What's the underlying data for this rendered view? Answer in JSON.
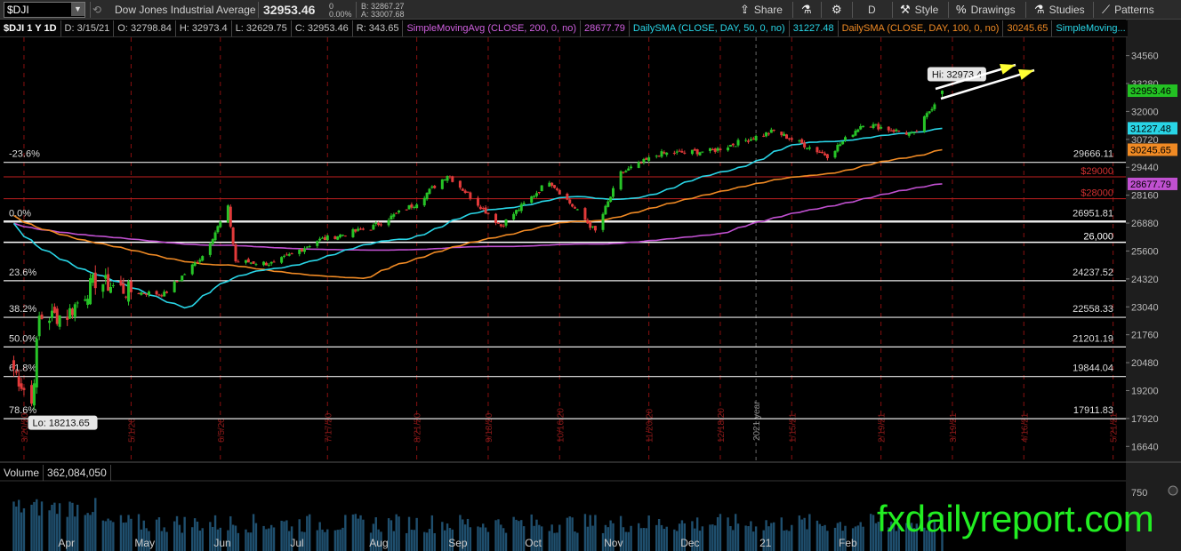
{
  "toolbar": {
    "symbol_value": "$DJI",
    "description": "Dow Jones Industrial Average",
    "last_price": "32953.46",
    "change": "0",
    "change_pct": "0.00%",
    "bid": "B: 32867.27",
    "ask": "A: 33007.68",
    "share_label": "Share",
    "period_label": "D",
    "style_label": "Style",
    "drawings_label": "Drawings",
    "studies_label": "Studies",
    "patterns_label": "Patterns"
  },
  "infobar": {
    "symbol": "$DJI 1 Y 1D",
    "date": "D: 3/15/21",
    "open": "O: 32798.84",
    "high": "H: 32973.4",
    "low": "L: 32629.75",
    "close": "C: 32953.46",
    "range": "R: 343.65",
    "sma200_label": "SimpleMovingAvg (CLOSE, 200, 0, no)",
    "sma200_value": "28677.79",
    "sma50_label": "DailySMA (CLOSE, DAY, 50, 0, no)",
    "sma50_value": "31227.48",
    "sma100_label": "DailySMA (CLOSE, DAY, 100, 0, no)",
    "sma100_value": "30245.65",
    "more_label": "SimpleMoving..."
  },
  "colors": {
    "up": "#27c427",
    "down": "#e23a3a",
    "sma50": "#29d5e6",
    "sma100": "#f08a24",
    "sma200": "#c050d0",
    "price_tag": "#23c123",
    "arrow": "#ffff33"
  },
  "price_axis": {
    "ticks": [
      "34560",
      "33280",
      "32000",
      "30720",
      "29440",
      "28160",
      "26880",
      "25600",
      "24320",
      "23040",
      "21760",
      "20480",
      "19200",
      "17920",
      "16640"
    ],
    "last_price_tag": "32953.46",
    "sma50_tag": "31227.48",
    "sma100_tag": "30245.65",
    "sma200_tag": "28677.79"
  },
  "chart_data": {
    "type": "candlestick",
    "symbol": "$DJI",
    "period": "1 Y 1D",
    "ylim": [
      16000,
      35400
    ],
    "x_month_labels": [
      "Apr",
      "May",
      "Jun",
      "Jul",
      "Aug",
      "Sep",
      "Oct",
      "Nov",
      "Dec",
      "21",
      "Feb"
    ],
    "close_path": [
      {
        "date": "2020-03-16",
        "close": 20189
      },
      {
        "date": "2020-03-23",
        "close": 18592
      },
      {
        "date": "2020-03-26",
        "close": 22552
      },
      {
        "date": "2020-04-06",
        "close": 22680
      },
      {
        "date": "2020-04-17",
        "close": 24242
      },
      {
        "date": "2020-05-01",
        "close": 23724
      },
      {
        "date": "2020-05-14",
        "close": 23625
      },
      {
        "date": "2020-05-29",
        "close": 25383
      },
      {
        "date": "2020-06-08",
        "close": 27572
      },
      {
        "date": "2020-06-11",
        "close": 25128
      },
      {
        "date": "2020-06-26",
        "close": 25015
      },
      {
        "date": "2020-07-13",
        "close": 26085
      },
      {
        "date": "2020-08-03",
        "close": 26664
      },
      {
        "date": "2020-08-20",
        "close": 27739
      },
      {
        "date": "2020-09-02",
        "close": 29100
      },
      {
        "date": "2020-09-23",
        "close": 26763
      },
      {
        "date": "2020-10-12",
        "close": 28837
      },
      {
        "date": "2020-10-30",
        "close": 26501
      },
      {
        "date": "2020-11-09",
        "close": 29157
      },
      {
        "date": "2020-11-24",
        "close": 30046
      },
      {
        "date": "2020-12-15",
        "close": 30199
      },
      {
        "date": "2021-01-08",
        "close": 31097
      },
      {
        "date": "2021-01-29",
        "close": 29982
      },
      {
        "date": "2021-02-12",
        "close": 31458
      },
      {
        "date": "2021-03-04",
        "close": 30924
      },
      {
        "date": "2021-03-15",
        "close": 32953
      }
    ],
    "hi_label": "Hi: 32973.4",
    "lo_label": "Lo: 18213.65",
    "sma_lines": [
      {
        "name": "DailySMA 50",
        "last": 31227.48
      },
      {
        "name": "DailySMA 100",
        "last": 30245.65
      },
      {
        "name": "SimpleMovingAvg 200",
        "last": 28677.79
      }
    ],
    "fib_levels": [
      {
        "label": "-23.6%",
        "value": 29666.11
      },
      {
        "label": "0.0%",
        "value": 26951.81
      },
      {
        "label": "23.6%",
        "value": 24237.52
      },
      {
        "label": "38.2%",
        "value": 22558.33
      },
      {
        "label": "50.0%",
        "value": 21201.19
      },
      {
        "label": "61.8%",
        "value": 19844.04
      },
      {
        "label": "78.6%",
        "value": 17911.83
      }
    ],
    "horizontal_levels": [
      {
        "label": "$29000",
        "value": 29000
      },
      {
        "label": "$28000",
        "value": 28000
      },
      {
        "label": "26,000",
        "value": 26000
      }
    ],
    "date_markers": [
      "3/20/20",
      "5/1/20",
      "6/5/20",
      "7/17/20",
      "8/21/20",
      "9/18/20",
      "10/16/20",
      "11/20/20",
      "12/18/20",
      "1/15/21",
      "2/19/21",
      "3/19/21",
      "4/16/21",
      "5/21/21"
    ],
    "year_marker": "2021 year"
  },
  "volume": {
    "label": "Volume",
    "value": "362,084,050",
    "axis_tick": "750"
  },
  "watermark": "fxdailyreport.com"
}
